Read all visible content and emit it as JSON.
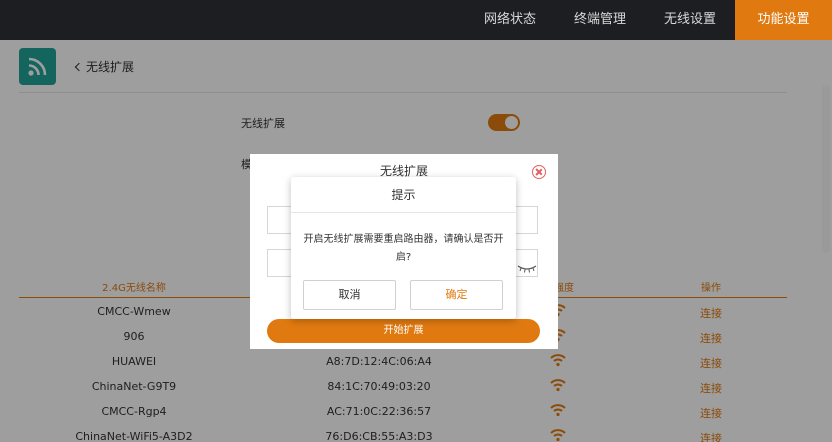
{
  "nav": {
    "items": [
      {
        "label": "网络状态"
      },
      {
        "label": "终端管理"
      },
      {
        "label": "无线设置"
      },
      {
        "label": "功能设置",
        "active": true
      }
    ]
  },
  "header": {
    "back_label": "无线扩展"
  },
  "settings": {
    "wireless_ext_label": "无线扩展",
    "partial_label": "模",
    "toggle_on": true
  },
  "table": {
    "headers": [
      "2.4G无线名称",
      "强度",
      "操作"
    ],
    "rows": [
      {
        "name": "CMCC-Wmew",
        "mac": "",
        "action": "连接"
      },
      {
        "name": "906",
        "mac": "",
        "action": "连接"
      },
      {
        "name": "HUAWEI",
        "mac": "A8:7D:12:4C:06:A4",
        "action": "连接"
      },
      {
        "name": "ChinaNet-G9T9",
        "mac": "84:1C:70:49:03:20",
        "action": "连接"
      },
      {
        "name": "CMCC-Rgp4",
        "mac": "AC:71:0C:22:36:57",
        "action": "连接"
      },
      {
        "name": "ChinaNet-WiFi5-A3D2",
        "mac": "76:D6:CB:55:A3:D3",
        "action": "连接"
      }
    ]
  },
  "dialog": {
    "title": "无线扩展",
    "start_button": "开始扩展"
  },
  "prompt": {
    "title": "提示",
    "message": "开启无线扩展需要重启路由器，请确认是否开启?",
    "cancel": "取消",
    "confirm": "确定"
  },
  "colors": {
    "accent": "#e07a10",
    "nav_bg": "#1d1e22",
    "logo_bg": "#22a39a"
  }
}
